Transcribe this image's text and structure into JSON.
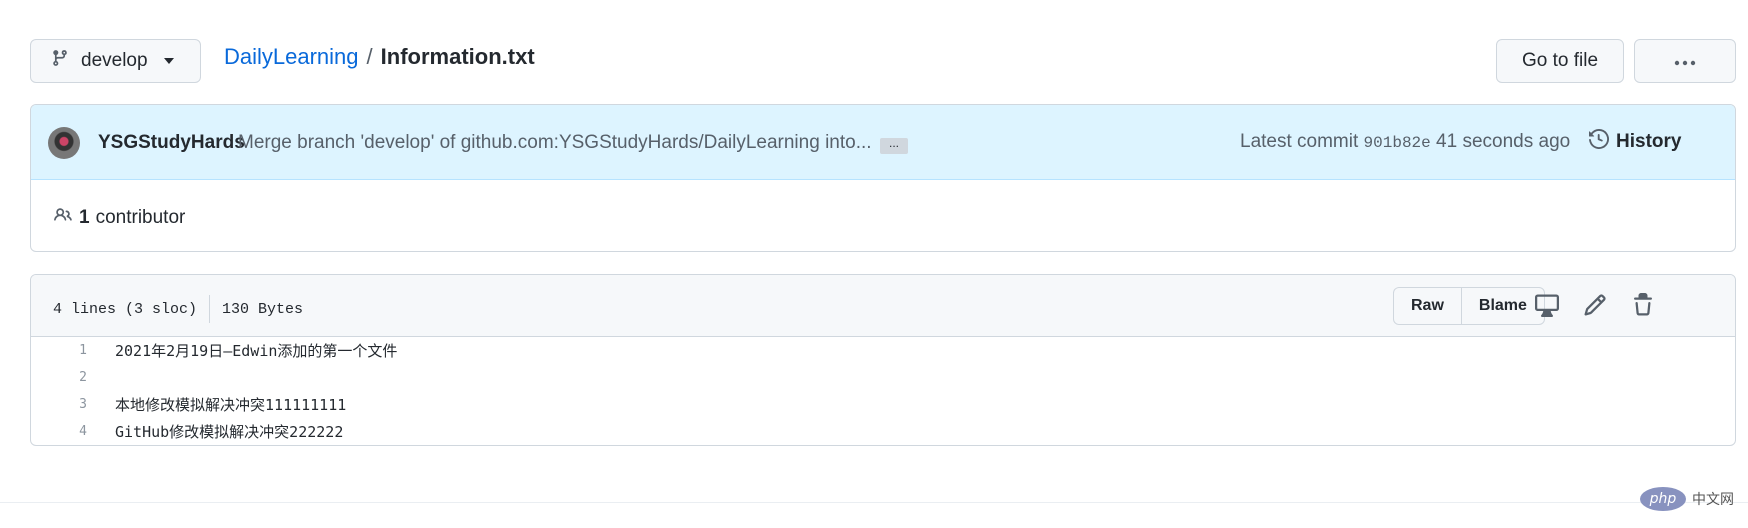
{
  "branch": {
    "name": "develop",
    "icon": "git-branch-icon"
  },
  "breadcrumb": {
    "repo": "DailyLearning",
    "separator": "/",
    "file": "Information.txt"
  },
  "toolbar": {
    "goto_label": "Go to file",
    "more_label": "···"
  },
  "commit": {
    "author": "YSGStudyHards",
    "message": "Merge branch 'develop' of github.com:YSGStudyHards/DailyLearning into...",
    "ellipsis": "...",
    "latest_label": "Latest commit",
    "sha": "901b82e",
    "time": "41 seconds ago",
    "history_label": "History"
  },
  "contributors": {
    "count": "1",
    "label": "contributor"
  },
  "file": {
    "lines_info": "4 lines (3 sloc)",
    "size": "130 Bytes",
    "raw_label": "Raw",
    "blame_label": "Blame",
    "lines": [
      {
        "num": "1",
        "text": "2021年2月19日—Edwin添加的第一个文件"
      },
      {
        "num": "2",
        "text": ""
      },
      {
        "num": "3",
        "text": "本地修改模拟解决冲突111111111"
      },
      {
        "num": "4",
        "text": "GitHub修改模拟解决冲突222222"
      }
    ]
  },
  "watermark": {
    "logo": "php",
    "site": "中文网"
  },
  "colors": {
    "link": "#0969da",
    "commit_bg": "#ddf4ff",
    "border": "#d0d7de",
    "header_bg": "#f6f8fa"
  }
}
